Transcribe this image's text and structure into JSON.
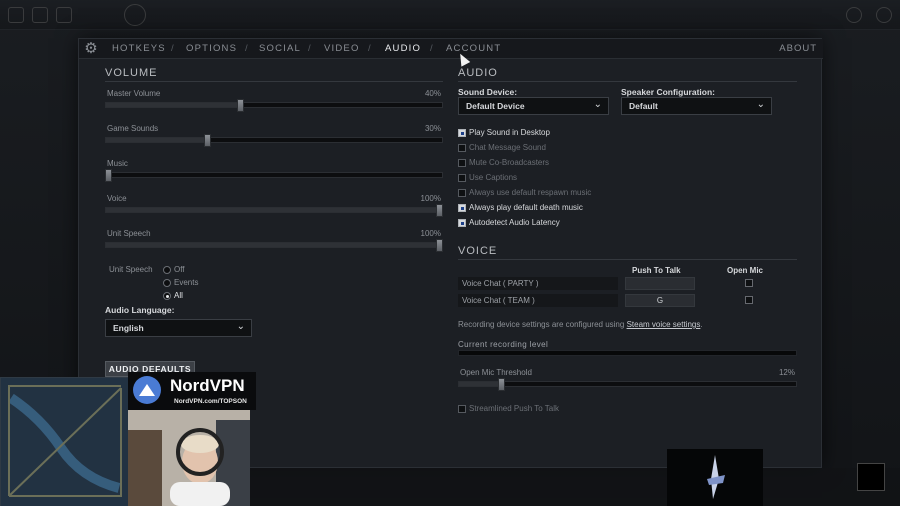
{
  "tabs": [
    {
      "label": "HOTKEYS"
    },
    {
      "label": "OPTIONS"
    },
    {
      "label": "SOCIAL"
    },
    {
      "label": "VIDEO"
    },
    {
      "label": "AUDIO"
    },
    {
      "label": "ACCOUNT"
    }
  ],
  "tab_separator": "/",
  "active_tab": "AUDIO",
  "about_label": "ABOUT",
  "volume": {
    "title": "VOLUME",
    "sliders": [
      {
        "label": "Master Volume",
        "value": "40%",
        "level": 0.4
      },
      {
        "label": "Game Sounds",
        "value": "30%",
        "level": 0.3
      },
      {
        "label": "Music",
        "value": "",
        "level": 0.0
      },
      {
        "label": "Voice",
        "value": "100%",
        "level": 1.0
      },
      {
        "label": "Unit Speech",
        "value": "100%",
        "level": 1.0
      }
    ],
    "unit_speech_caption": "Unit Speech",
    "unit_speech_options": [
      {
        "label": "Off",
        "selected": false
      },
      {
        "label": "Events",
        "selected": false
      },
      {
        "label": "All",
        "selected": true
      }
    ],
    "audio_language_label": "Audio Language:",
    "audio_language_value": "English",
    "defaults_button": "AUDIO DEFAULTS"
  },
  "audio": {
    "title": "AUDIO",
    "sound_device_label": "Sound Device:",
    "sound_device_value": "Default Device",
    "speaker_config_label": "Speaker Configuration:",
    "speaker_config_value": "Default",
    "checkboxes": [
      {
        "label": "Play Sound in Desktop",
        "checked": true
      },
      {
        "label": "Chat Message Sound",
        "checked": false
      },
      {
        "label": "Mute Co-Broadcasters",
        "checked": false
      },
      {
        "label": "Use Captions",
        "checked": false
      },
      {
        "label": "Always use default respawn music",
        "checked": false
      },
      {
        "label": "Always play default death music",
        "checked": true
      },
      {
        "label": "Autodetect Audio Latency",
        "checked": true
      }
    ]
  },
  "voice": {
    "title": "VOICE",
    "col_push_to_talk": "Push To Talk",
    "col_open_mic": "Open Mic",
    "rows": [
      {
        "label": "Voice Chat ( PARTY )",
        "key": "",
        "open_mic": false
      },
      {
        "label": "Voice Chat ( TEAM )",
        "key": "G",
        "open_mic": false
      }
    ],
    "info_prefix": "Recording device settings are configured using",
    "info_link": "Steam voice settings",
    "info_suffix": ".",
    "recording_level_label": "Current recording level",
    "recording_level": 0.0,
    "threshold_label": "Open Mic Threshold",
    "threshold_value": "12%",
    "threshold_level": 0.12,
    "streamlined_label": "Streamlined Push To Talk",
    "streamlined_checked": false
  },
  "overlay": {
    "sponsor_name": "NordVPN",
    "sponsor_url": "NordVPN.com/TOPSON"
  },
  "colors": {
    "panel_bg": "#1c1f24",
    "accent_text": "#e8eaed",
    "nord_blue": "#4a7bd4"
  }
}
